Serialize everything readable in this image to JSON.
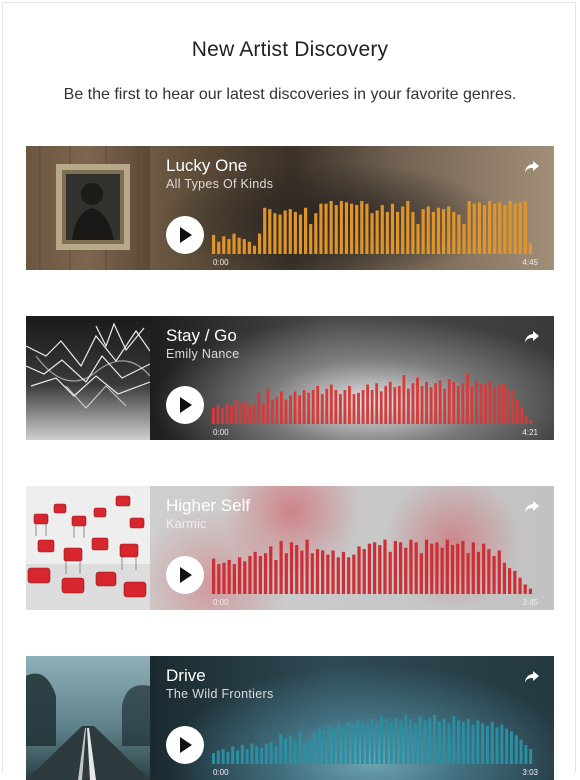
{
  "header": {
    "title": "New Artist Discovery",
    "subtitle": "Be the first to hear our latest discoveries in your favorite genres."
  },
  "tracks": [
    {
      "title": "Lucky One",
      "artist": "All Types Of Kinds",
      "time_start": "0:00",
      "time_end": "4:45",
      "wave_color": "#e0952a",
      "bg": "#5a4a35",
      "wave": [
        0.28,
        0.18,
        0.26,
        0.22,
        0.3,
        0.24,
        0.22,
        0.18,
        0.12,
        0.3,
        0.68,
        0.66,
        0.6,
        0.58,
        0.64,
        0.66,
        0.62,
        0.58,
        0.68,
        0.44,
        0.6,
        0.74,
        0.74,
        0.78,
        0.72,
        0.78,
        0.76,
        0.74,
        0.72,
        0.78,
        0.74,
        0.6,
        0.64,
        0.72,
        0.62,
        0.74,
        0.62,
        0.7,
        0.78,
        0.62,
        0.44,
        0.66,
        0.7,
        0.62,
        0.68,
        0.66,
        0.7,
        0.62,
        0.58,
        0.44,
        0.78,
        0.74,
        0.76,
        0.72,
        0.78,
        0.74,
        0.76,
        0.72,
        0.78,
        0.74,
        0.76,
        0.78,
        0.16
      ]
    },
    {
      "title": "Stay / Go",
      "artist": "Emily Nance",
      "time_start": "0:00",
      "time_end": "4:21",
      "wave_color": "#d63a3a",
      "bg": "#5c5c5c",
      "wave": [
        0.24,
        0.28,
        0.24,
        0.3,
        0.28,
        0.36,
        0.3,
        0.34,
        0.28,
        0.3,
        0.46,
        0.3,
        0.52,
        0.36,
        0.4,
        0.48,
        0.36,
        0.42,
        0.48,
        0.42,
        0.5,
        0.46,
        0.5,
        0.56,
        0.44,
        0.52,
        0.58,
        0.5,
        0.44,
        0.5,
        0.56,
        0.44,
        0.46,
        0.5,
        0.58,
        0.5,
        0.6,
        0.48,
        0.56,
        0.62,
        0.54,
        0.56,
        0.72,
        0.52,
        0.6,
        0.68,
        0.56,
        0.62,
        0.54,
        0.6,
        0.64,
        0.52,
        0.66,
        0.62,
        0.56,
        0.6,
        0.74,
        0.56,
        0.64,
        0.6,
        0.58,
        0.62,
        0.54,
        0.58,
        0.6,
        0.52,
        0.5,
        0.36,
        0.24,
        0.12,
        0.06
      ]
    },
    {
      "title": "Higher Self",
      "artist": "Karmic",
      "time_start": "0:00",
      "time_end": "3:45",
      "wave_color": "#cc2f35",
      "bg": "#c9c9c9",
      "wave": [
        0.52,
        0.44,
        0.46,
        0.5,
        0.44,
        0.54,
        0.48,
        0.56,
        0.62,
        0.56,
        0.6,
        0.7,
        0.5,
        0.78,
        0.6,
        0.76,
        0.72,
        0.64,
        0.8,
        0.6,
        0.66,
        0.64,
        0.58,
        0.64,
        0.54,
        0.62,
        0.54,
        0.58,
        0.7,
        0.66,
        0.74,
        0.76,
        0.72,
        0.8,
        0.62,
        0.78,
        0.76,
        0.68,
        0.8,
        0.76,
        0.6,
        0.8,
        0.74,
        0.76,
        0.68,
        0.8,
        0.72,
        0.74,
        0.78,
        0.6,
        0.76,
        0.62,
        0.74,
        0.66,
        0.56,
        0.64,
        0.46,
        0.38,
        0.34,
        0.24,
        0.14,
        0.08
      ]
    },
    {
      "title": "Drive",
      "artist": "The Wild Frontiers",
      "time_start": "0:00",
      "time_end": "3:03",
      "wave_color": "#2a8fa3",
      "bg": "#2a4a55",
      "wave": [
        0.16,
        0.2,
        0.22,
        0.18,
        0.26,
        0.2,
        0.28,
        0.22,
        0.3,
        0.26,
        0.24,
        0.3,
        0.32,
        0.26,
        0.44,
        0.38,
        0.42,
        0.34,
        0.48,
        0.3,
        0.36,
        0.48,
        0.54,
        0.5,
        0.56,
        0.52,
        0.6,
        0.54,
        0.62,
        0.58,
        0.64,
        0.62,
        0.58,
        0.66,
        0.6,
        0.7,
        0.66,
        0.62,
        0.68,
        0.64,
        0.72,
        0.66,
        0.6,
        0.7,
        0.64,
        0.68,
        0.72,
        0.62,
        0.66,
        0.6,
        0.7,
        0.64,
        0.62,
        0.66,
        0.58,
        0.64,
        0.6,
        0.56,
        0.62,
        0.54,
        0.58,
        0.52,
        0.48,
        0.42,
        0.36,
        0.28,
        0.22
      ]
    }
  ]
}
